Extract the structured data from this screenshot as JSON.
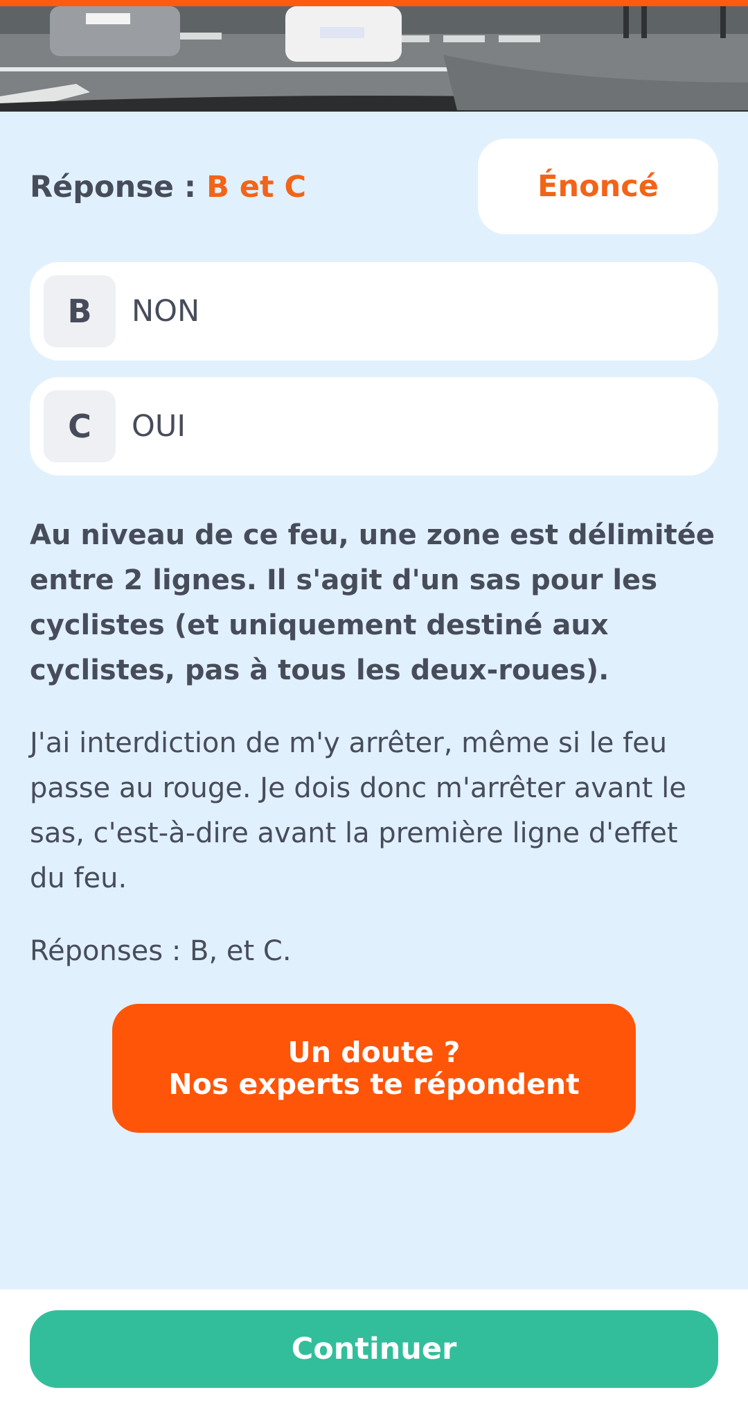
{
  "answer": {
    "label": "Réponse : ",
    "value": "B et C"
  },
  "enonce_button": {
    "label": "Énoncé"
  },
  "choices": [
    {
      "letter": "B",
      "text": "NON"
    },
    {
      "letter": "C",
      "text": "OUI"
    }
  ],
  "explanation": {
    "bold": "Au niveau de ce feu, une zone est délimitée entre 2 lignes. Il s'agit d'un sas pour les cyclistes (et uniquement destiné aux cyclistes, pas à tous les deux-roues).",
    "normal": "J'ai interdiction de m'y arrêter, même si le feu passe au rouge. Je dois donc m'arrêter avant le sas, c'est-à-dire avant la première ligne d'effet du feu.",
    "answers": "Réponses : B, et C."
  },
  "doubt_button": {
    "line1": "Un doute ?",
    "line2": "Nos experts te répondent"
  },
  "continue_button": {
    "label": "Continuer"
  },
  "colors": {
    "accent": "#ff5508",
    "answer_highlight": "#f26418",
    "continue": "#33be9b",
    "background": "#e1f0fd",
    "text": "#474c5b"
  }
}
